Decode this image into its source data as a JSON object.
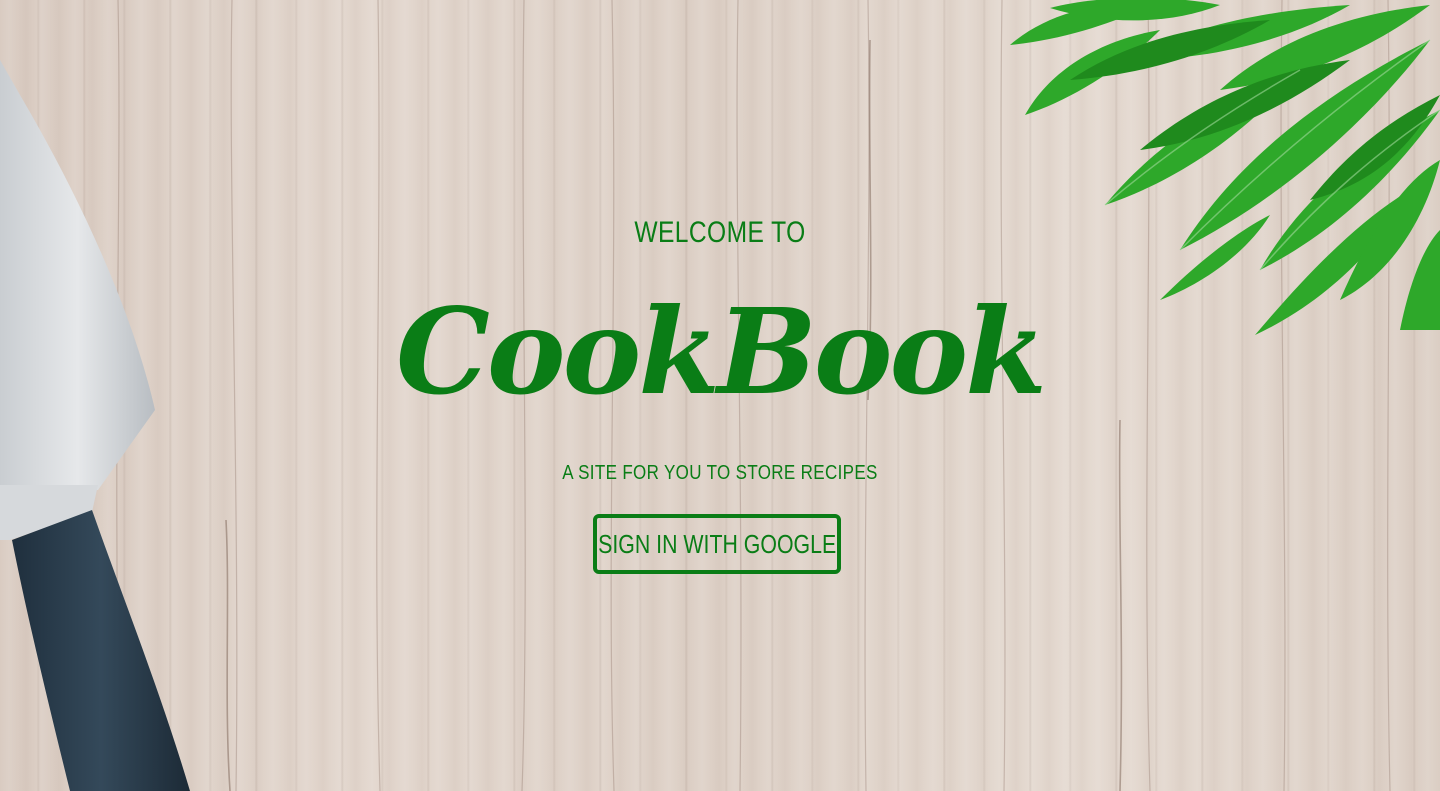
{
  "hero": {
    "welcome": "WELCOME TO",
    "brand": "CookBook",
    "tagline": "A SITE FOR YOU TO STORE RECIPES",
    "signin_label": "SIGN IN WITH GOOGLE"
  },
  "colors": {
    "accent": "#0a7d16",
    "background": "#ddd0c6"
  },
  "icons": {
    "knife": "knife-illustration",
    "leaves": "herb-leaves-illustration"
  }
}
